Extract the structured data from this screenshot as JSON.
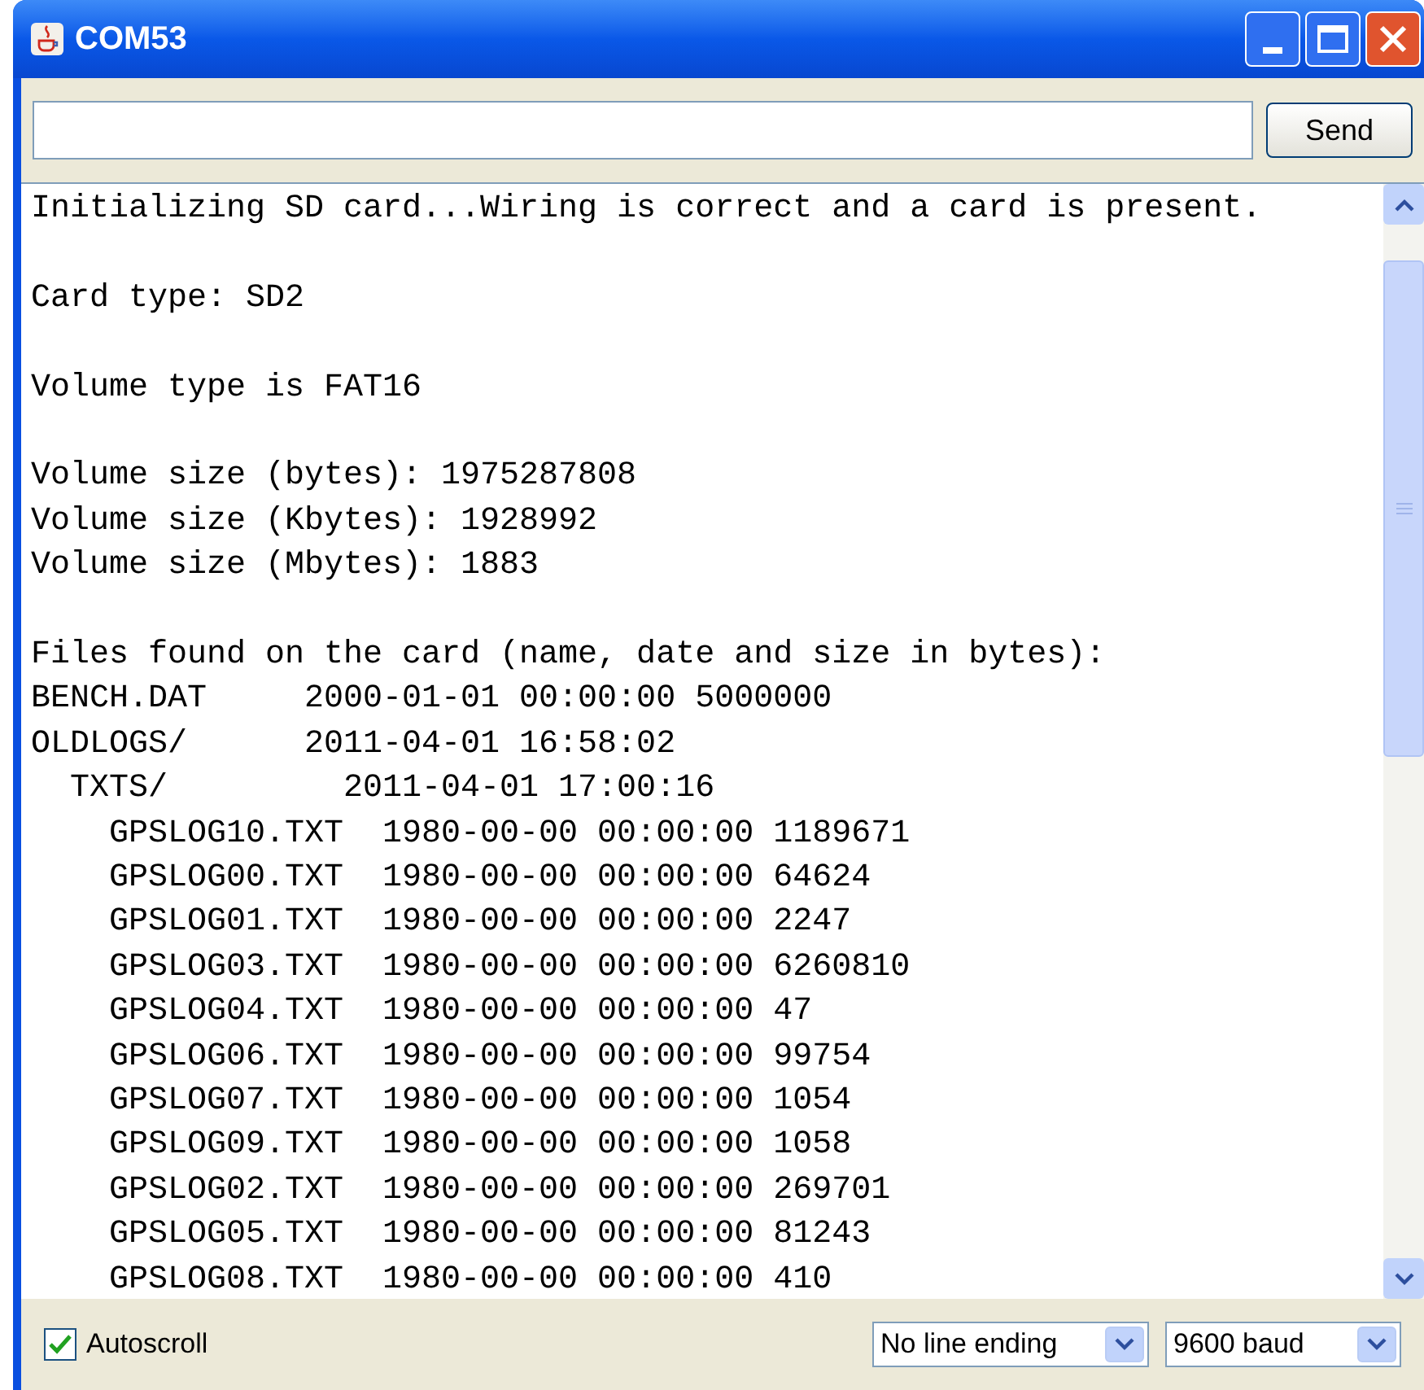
{
  "window": {
    "title": "COM53"
  },
  "send_button": "Send",
  "output_blocks": [
    [
      "Initializing SD card...Wiring is correct and a card is present."
    ],
    [
      "Card type: SD2"
    ],
    [
      "Volume type is FAT16"
    ],
    [
      "Volume size (bytes): 1975287808",
      "Volume size (Kbytes): 1928992",
      "Volume size (Mbytes): 1883"
    ],
    [
      "Files found on the card (name, date and size in bytes):",
      "BENCH.DAT     2000-01-01 00:00:00 5000000",
      "OLDLOGS/      2011-04-01 16:58:02",
      "  TXTS/         2011-04-01 17:00:16",
      "    GPSLOG10.TXT  1980-00-00 00:00:00 1189671",
      "    GPSLOG00.TXT  1980-00-00 00:00:00 64624",
      "    GPSLOG01.TXT  1980-00-00 00:00:00 2247",
      "    GPSLOG03.TXT  1980-00-00 00:00:00 6260810",
      "    GPSLOG04.TXT  1980-00-00 00:00:00 47",
      "    GPSLOG06.TXT  1980-00-00 00:00:00 99754",
      "    GPSLOG07.TXT  1980-00-00 00:00:00 1054",
      "    GPSLOG09.TXT  1980-00-00 00:00:00 1058",
      "    GPSLOG02.TXT  1980-00-00 00:00:00 269701",
      "    GPSLOG05.TXT  1980-00-00 00:00:00 81243",
      "    GPSLOG08.TXT  1980-00-00 00:00:00 410"
    ]
  ],
  "autoscroll": {
    "label": "Autoscroll",
    "checked": true
  },
  "line_ending": "No line ending",
  "baud": "9600 baud"
}
